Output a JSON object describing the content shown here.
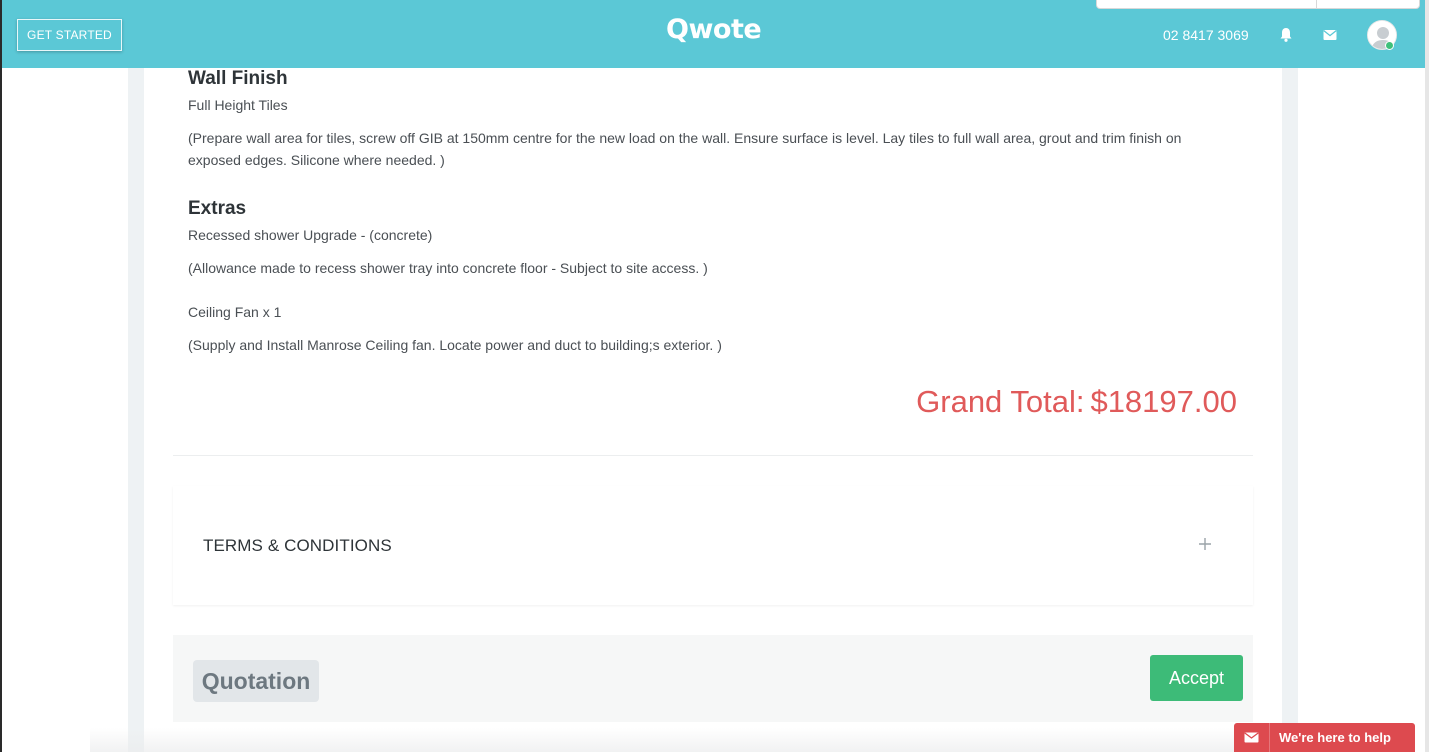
{
  "header": {
    "get_started_label": "GET STARTED",
    "logo_text": "Qwote",
    "phone": "02 8417 3069"
  },
  "quote": {
    "wall_finish": {
      "title": "Wall Finish",
      "item": "Full Height Tiles",
      "description": "(Prepare wall area for tiles, screw off GIB at 150mm centre for the new load on the wall. Ensure surface is level. Lay tiles to full wall area, grout and trim finish on exposed edges. Silicone where needed. )"
    },
    "extras": {
      "title": "Extras",
      "items": [
        {
          "name": "Recessed shower Upgrade - (concrete)",
          "description": "(Allowance made to recess shower tray into concrete floor - Subject to site access. )"
        },
        {
          "name": "Ceiling Fan x 1",
          "description": "(Supply and Install Manrose Ceiling fan. Locate power and duct to building;s exterior. )"
        }
      ]
    },
    "grand_total_label": "Grand Total:",
    "grand_total_value": "$18197.00"
  },
  "terms": {
    "label": "TERMS & CONDITIONS"
  },
  "footer": {
    "quotation_label": "Quotation",
    "accept_label": "Accept"
  },
  "help_widget": {
    "label": "We're here to help"
  },
  "colors": {
    "header_bg": "#5bc8d6",
    "grand_total": "#e05a5a",
    "accept_bg": "#3dbb78",
    "help_bg": "#dd4a4f"
  }
}
